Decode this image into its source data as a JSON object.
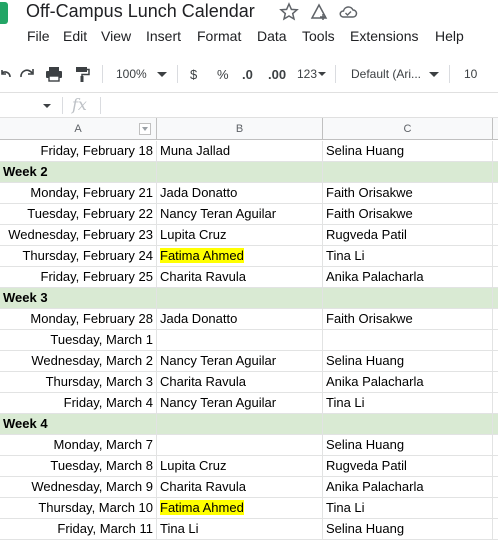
{
  "title": "Off-Campus Lunch Calendar",
  "menu": [
    "File",
    "Edit",
    "View",
    "Insert",
    "Format",
    "Data",
    "Tools",
    "Extensions",
    "Help"
  ],
  "toolbar": {
    "zoom": "100%",
    "currency": "$",
    "percent": "%",
    "decrease_decimal": ".0",
    "increase_decimal": ".00",
    "more_formats": "123",
    "font": "Default (Ari...",
    "font_size": "10"
  },
  "formula": {
    "fx": "fx",
    "value": ""
  },
  "columns": [
    "A",
    "B",
    "C"
  ],
  "colors": {
    "week_row": "#d9ead3",
    "highlight": "#ffff00",
    "app_icon": "#23a566"
  },
  "rows": [
    {
      "type": "day",
      "a": "Friday, February 18",
      "b": "Muna Jallad",
      "c": "Selina Huang",
      "hl": false
    },
    {
      "type": "week",
      "a": "Week 2",
      "b": "",
      "c": "",
      "hl": false
    },
    {
      "type": "day",
      "a": "Monday, February 21",
      "b": "Jada Donatto",
      "c": "Faith Orisakwe",
      "hl": false
    },
    {
      "type": "day",
      "a": "Tuesday, February 22",
      "b": "Nancy Teran Aguilar",
      "c": "Faith Orisakwe",
      "hl": false
    },
    {
      "type": "day",
      "a": "Wednesday, February 23",
      "b": "Lupita Cruz",
      "c": "Rugveda Patil",
      "hl": false
    },
    {
      "type": "day",
      "a": "Thursday, February 24",
      "b": "Fatima Ahmed",
      "c": "Tina Li",
      "hl": true
    },
    {
      "type": "day",
      "a": "Friday, February 25",
      "b": "Charita Ravula",
      "c": "Anika Palacharla",
      "hl": false
    },
    {
      "type": "week",
      "a": "Week 3",
      "b": "",
      "c": "",
      "hl": false
    },
    {
      "type": "day",
      "a": "Monday, February 28",
      "b": "Jada Donatto",
      "c": "Faith Orisakwe",
      "hl": false
    },
    {
      "type": "day",
      "a": "Tuesday, March 1",
      "b": "",
      "c": "",
      "hl": false
    },
    {
      "type": "day",
      "a": "Wednesday, March 2",
      "b": "Nancy Teran Aguilar",
      "c": "Selina Huang",
      "hl": false
    },
    {
      "type": "day",
      "a": "Thursday, March 3",
      "b": "Charita Ravula",
      "c": "Anika Palacharla",
      "hl": false
    },
    {
      "type": "day",
      "a": "Friday, March 4",
      "b": "Nancy Teran Aguilar",
      "c": "Tina Li",
      "hl": false
    },
    {
      "type": "week",
      "a": "Week 4",
      "b": "",
      "c": "",
      "hl": false
    },
    {
      "type": "day",
      "a": "Monday, March 7",
      "b": "",
      "c": "Selina Huang",
      "hl": false
    },
    {
      "type": "day",
      "a": "Tuesday, March 8",
      "b": "Lupita Cruz",
      "c": "Rugveda Patil",
      "hl": false
    },
    {
      "type": "day",
      "a": "Wednesday, March 9",
      "b": "Charita Ravula",
      "c": "Anika Palacharla",
      "hl": false
    },
    {
      "type": "day",
      "a": "Thursday, March 10",
      "b": "Fatima Ahmed",
      "c": "Tina Li",
      "hl": true
    },
    {
      "type": "day",
      "a": "Friday, March 11",
      "b": "Tina Li",
      "c": "Selina Huang",
      "hl": false
    }
  ]
}
